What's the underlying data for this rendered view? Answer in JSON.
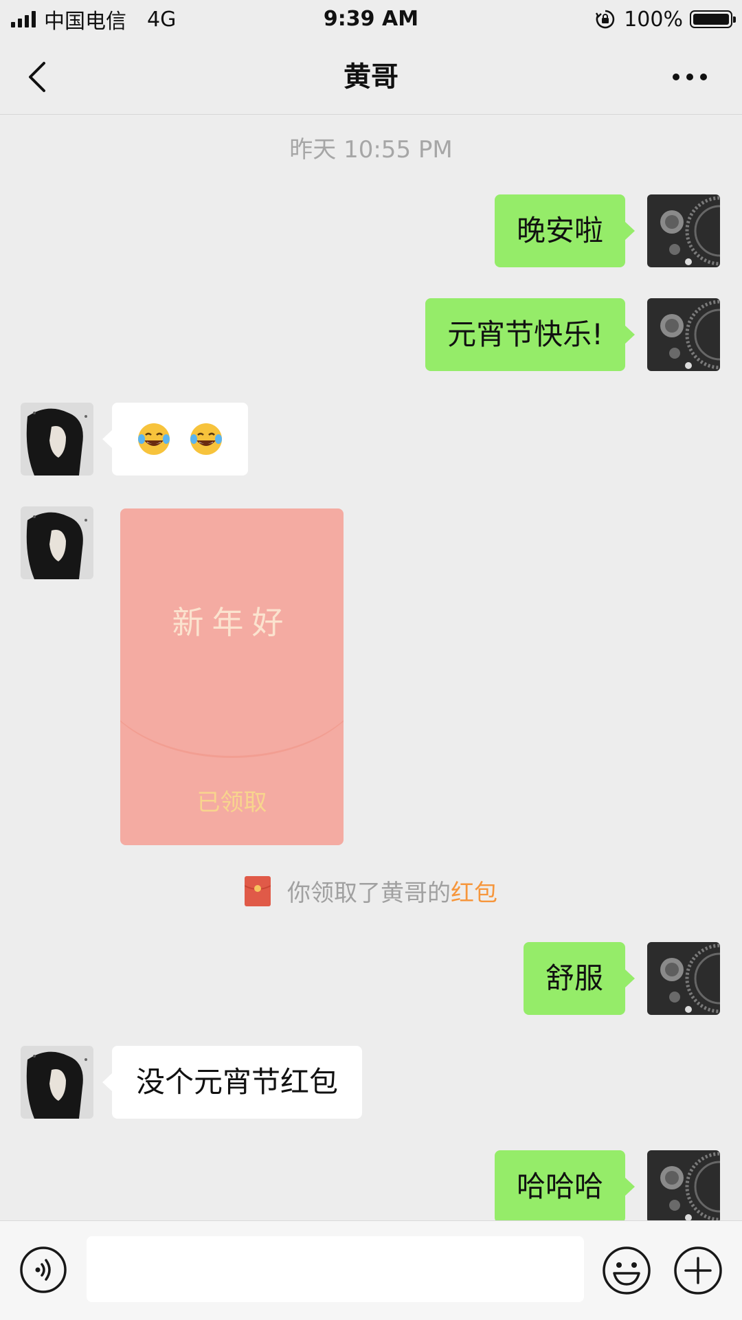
{
  "status_bar": {
    "carrier": "中国电信",
    "network": "4G",
    "time": "9:39 AM",
    "battery_percent": "100%",
    "battery_level": 1.0
  },
  "nav": {
    "title": "黄哥",
    "back_icon": "chevron-left-icon",
    "more_icon": "ellipsis-icon"
  },
  "chat": {
    "timestamp": "昨天 10:55 PM",
    "messages": [
      {
        "side": "right",
        "text": "晚安啦"
      },
      {
        "side": "right",
        "text": "元宵节快乐!"
      },
      {
        "side": "left",
        "type": "emoji",
        "emojis": [
          "😂",
          "😂"
        ]
      },
      {
        "side": "left",
        "type": "red-envelope",
        "title": "新年好",
        "status": "已领取"
      },
      {
        "side": "right",
        "text": "舒服"
      },
      {
        "side": "left",
        "text": "没个元宵节红包"
      },
      {
        "side": "right",
        "text": "哈哈哈"
      }
    ],
    "system_message": {
      "text": "你领取了黄哥的",
      "link": "红包"
    }
  },
  "input_bar": {
    "placeholder": "",
    "icons": [
      "voice-icon",
      "emoji-icon",
      "plus-icon"
    ]
  },
  "colors": {
    "background": "#ededed",
    "sent_bubble": "#95ec69",
    "received_bubble": "#ffffff",
    "red_envelope": "#f4aba2",
    "link": "#f6963c"
  }
}
